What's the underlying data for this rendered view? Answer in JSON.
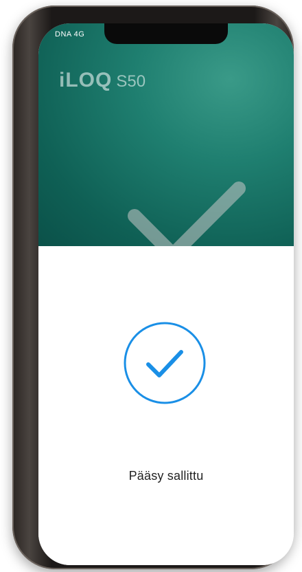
{
  "status_bar": {
    "carrier": "DNA  4G"
  },
  "header": {
    "brand_logo": "iLOQ",
    "brand_model": "S50"
  },
  "result": {
    "message": "Pääsy sallittu",
    "icon": "check-circle-icon"
  },
  "colors": {
    "hero_teal": "#16705f",
    "accent_blue": "#1a8fe6"
  }
}
